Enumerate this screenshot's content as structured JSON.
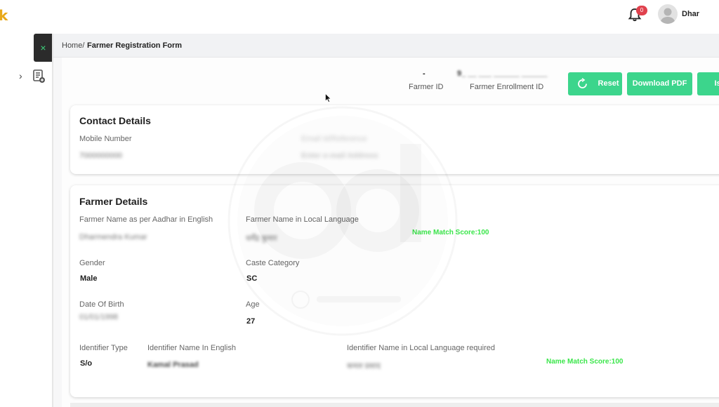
{
  "brand": {
    "fragment": "k"
  },
  "header": {
    "notification_count": "0",
    "user_name": "Dhar"
  },
  "sidebar": {
    "close_label": "×",
    "expand_label": "›"
  },
  "breadcrumb": {
    "home": "Home/",
    "current": "Farmer Registration Form"
  },
  "ids": {
    "farmer_id_value": "-",
    "farmer_id_label": "Farmer ID",
    "enrollment_id_value": "9_ __ ___ ______ ______",
    "enrollment_id_label": "Farmer Enrollment ID"
  },
  "actions": {
    "reset": "Reset",
    "download_pdf": "Download PDF",
    "issue": "Issu"
  },
  "contact": {
    "title": "Contact Details",
    "mobile_label": "Mobile Number",
    "mobile_value": "7000000000",
    "email_label": "Email Id/Reference",
    "email_value": "Enter e-mail Address"
  },
  "farmer": {
    "title": "Farmer Details",
    "name_en_label": "Farmer Name as per Aadhar in English",
    "name_en_value": "Dharmendra Kumar",
    "name_local_label": "Farmer Name in Local Language",
    "name_local_value": "धर्मेंद्र कुमार",
    "match_score_1": "Name Match Score:100",
    "gender_label": "Gender",
    "gender_value": "Male",
    "caste_label": "Caste Category",
    "caste_value": "SC",
    "dob_label": "Date Of Birth",
    "dob_value": "01/01/1998",
    "age_label": "Age",
    "age_value": "27",
    "identifier_type_label": "Identifier Type",
    "identifier_type_value": "S/o",
    "identifier_name_en_label": "Identifier Name In English",
    "identifier_name_en_value": "Kamal Prasad",
    "identifier_name_local_label": "Identifier Name in Local Language required",
    "identifier_name_local_value": "कमल प्रसाद",
    "match_score_2": "Name Match Score:100"
  },
  "colors": {
    "accent": "#3cd58c",
    "match": "#3ae64a",
    "badge": "#e0414d",
    "brand": "#e8a91a"
  }
}
